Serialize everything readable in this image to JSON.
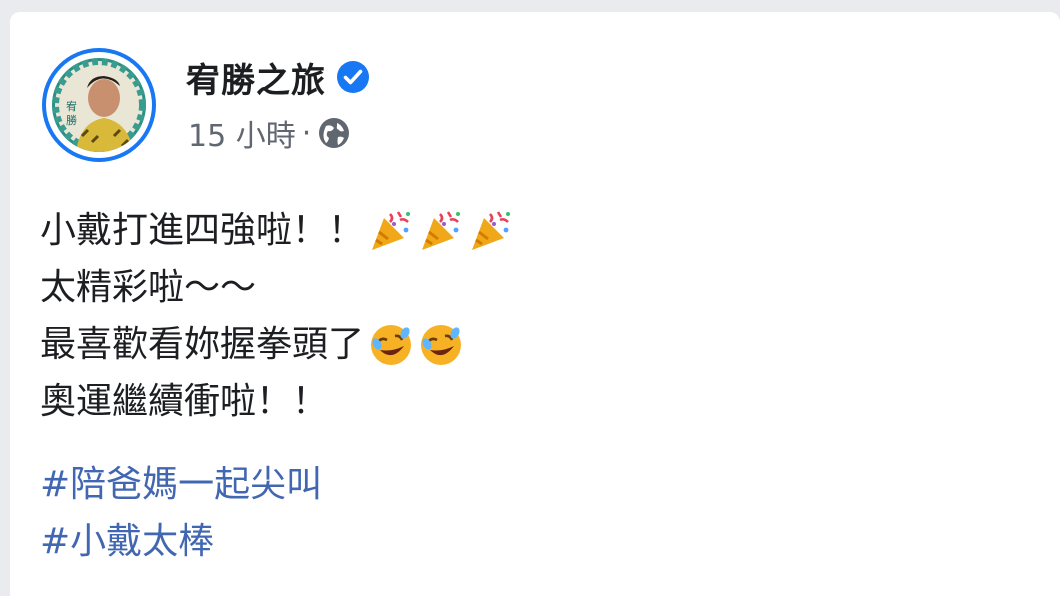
{
  "post": {
    "author": "宥勝之旅",
    "verified": true,
    "timestamp": "15 小時",
    "separator": "·",
    "audience_icon": "globe-icon",
    "lines": [
      {
        "text": "小戴打進四強啦！！",
        "emojis": [
          "party-popper",
          "party-popper",
          "party-popper"
        ]
      },
      {
        "text": "太精彩啦～～",
        "emojis": []
      },
      {
        "text": "最喜歡看妳握拳頭了",
        "emojis": [
          "rolling-laughing",
          "rolling-laughing"
        ]
      },
      {
        "text": "奧運繼續衝啦！！",
        "emojis": []
      }
    ],
    "hashtags": [
      "#陪爸媽一起尖叫",
      "#小戴太棒"
    ]
  },
  "colors": {
    "brand_blue": "#1877f2",
    "hashtag_blue": "#4267b2",
    "meta_gray": "#606770"
  }
}
